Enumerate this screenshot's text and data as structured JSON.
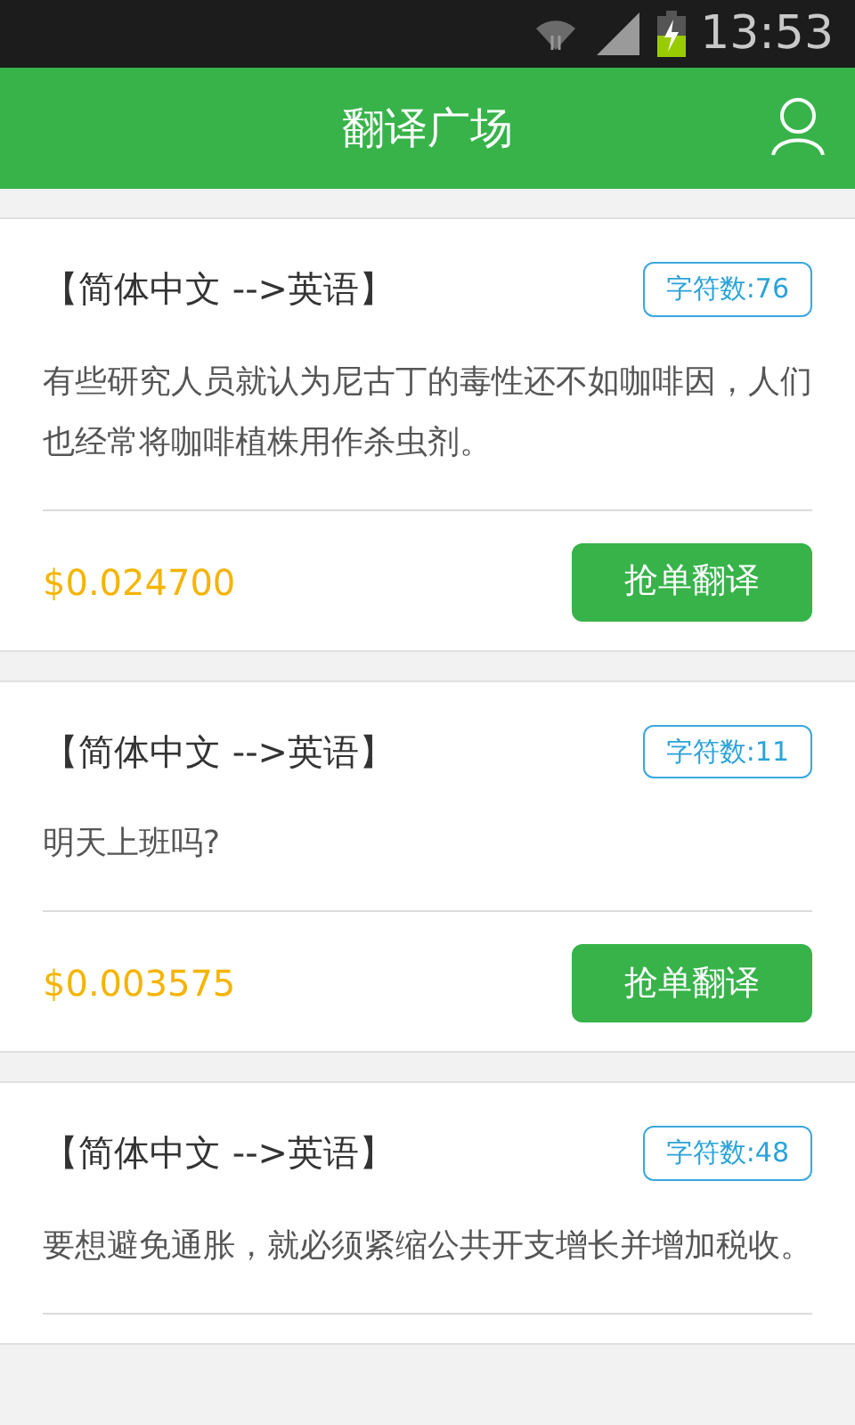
{
  "status_bar": {
    "time": "13:53"
  },
  "header": {
    "title": "翻译广场"
  },
  "tasks": [
    {
      "language": "【简体中文 -->英语】",
      "char_count": "字符数:76",
      "text": "有些研究人员就认为尼古丁的毒性还不如咖啡因，人们也经常将咖啡植株用作杀虫剂。",
      "price": "$0.024700",
      "action": "抢单翻译"
    },
    {
      "language": "【简体中文 -->英语】",
      "char_count": "字符数:11",
      "text": "明天上班吗?",
      "price": "$0.003575",
      "action": "抢单翻译"
    },
    {
      "language": "【简体中文 -->英语】",
      "char_count": "字符数:48",
      "text": "要想避免通胀，就必须紧缩公共开支增长并增加税收。"
    }
  ]
}
